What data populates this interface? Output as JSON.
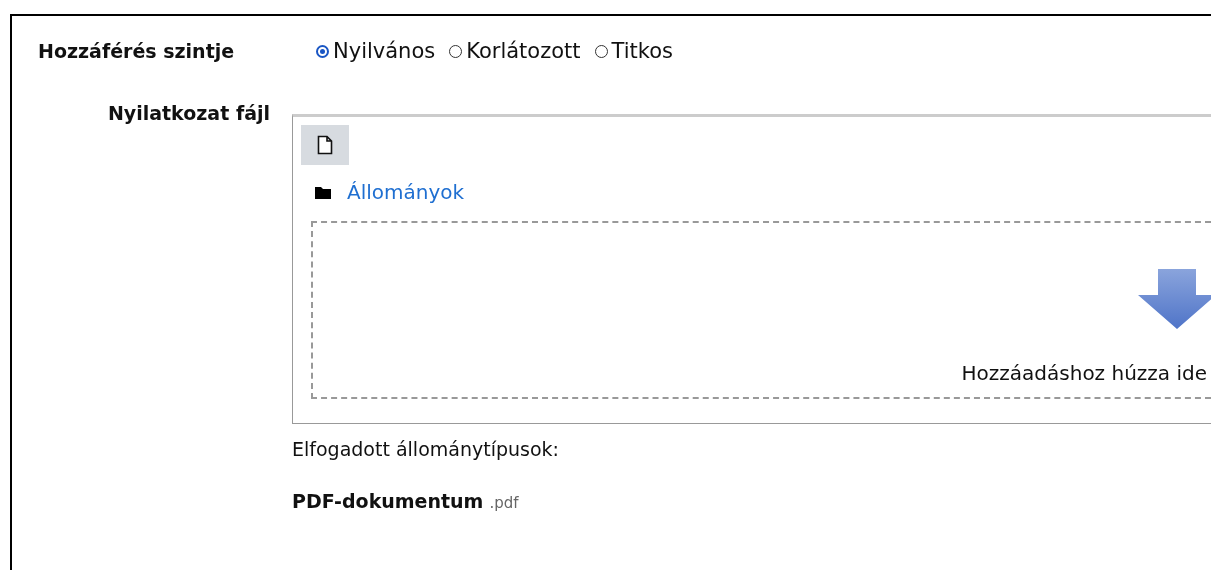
{
  "access_level": {
    "label": "Hozzáférés szintje",
    "options": [
      {
        "label": "Nyilvános",
        "selected": true
      },
      {
        "label": "Korlátozott",
        "selected": false
      },
      {
        "label": "Titkos",
        "selected": false
      }
    ]
  },
  "declaration_file": {
    "label": "Nyilatkozat fájl",
    "folder_link": "Állományok",
    "drop_hint": "Hozzáadáshoz húzza ide",
    "accepted_types_label": "Elfogadott állománytípusok:",
    "accepted_types": [
      {
        "name": "PDF-dokumentum",
        "extension": ".pdf"
      }
    ]
  }
}
